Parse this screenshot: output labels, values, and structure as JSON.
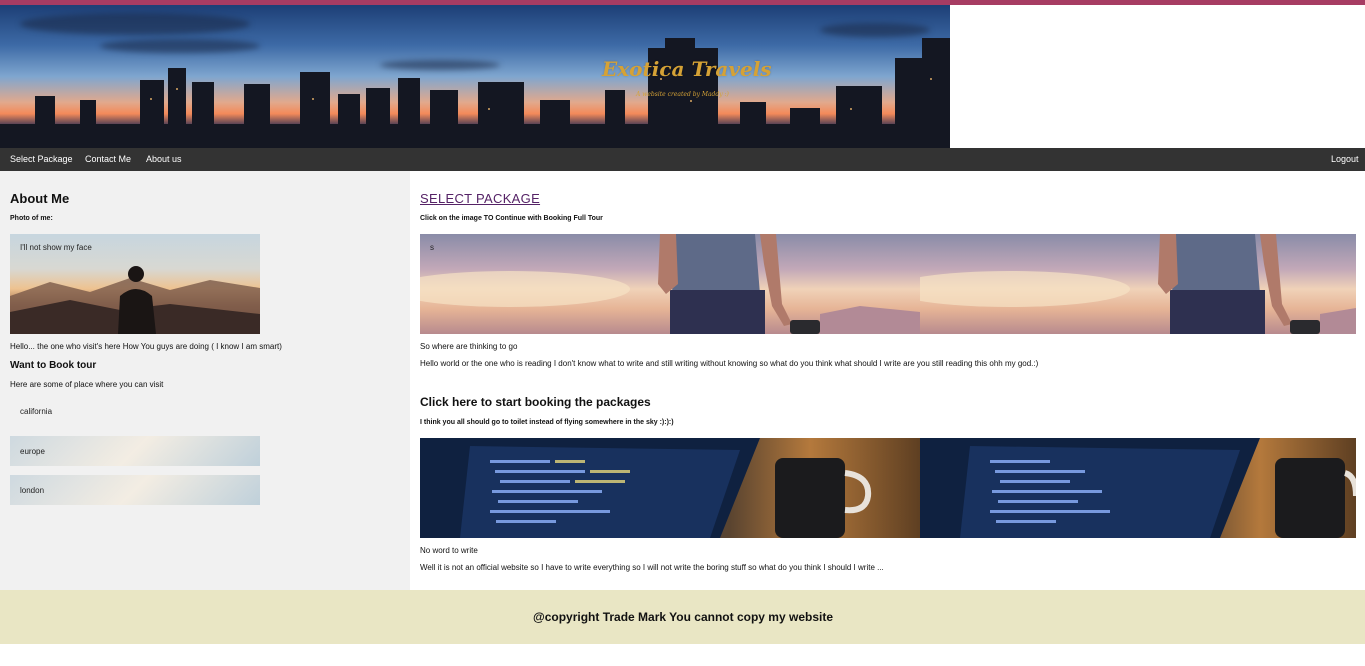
{
  "header": {
    "title": "Exotica Travels",
    "subtitle": "A website created by Maddy :)"
  },
  "nav": {
    "items": [
      "Select Package",
      "Contact Me",
      "About us"
    ],
    "logout": "Logout"
  },
  "sidebar": {
    "about_title": "About Me",
    "photo_label": "Photo of me:",
    "photo_caption": "I'll not show my face",
    "intro": "Hello... the one who visit's here How You guys are doing ( I know I am smart)",
    "book_title": "Want to Book tour",
    "book_text": "Here are some of place where you can visit",
    "places": [
      "california",
      "europe",
      "london"
    ]
  },
  "main": {
    "section1": {
      "title": "SELECT PACKAGE",
      "subtitle": "Click on the image TO Continue with Booking Full Tour",
      "image_mark": "s",
      "heading": "So where are thinking to go",
      "text": "Hello world or the one who is reading I don't know what to write and still writing without knowing so what do you think what should I write are you still reading this ohh my god.:)"
    },
    "section2": {
      "title": "Click here to start booking the packages",
      "subtitle": "I think you all should go to toilet instead of flying somewhere in the sky :):):)",
      "heading": "No word to write",
      "text": "Well it is not an official website so I have to write everything so I will not write the boring stuff so what do you think I should I write ..."
    }
  },
  "footer": {
    "text": "@copyright Trade Mark You cannot copy my website"
  },
  "colors": {
    "nav_bg": "#333333",
    "sidebar_bg": "#f1f1f1",
    "footer_bg": "#e9e6c4",
    "title_gold": "#d5a236",
    "link_purple": "#552266",
    "topbar": "#a73c63"
  }
}
